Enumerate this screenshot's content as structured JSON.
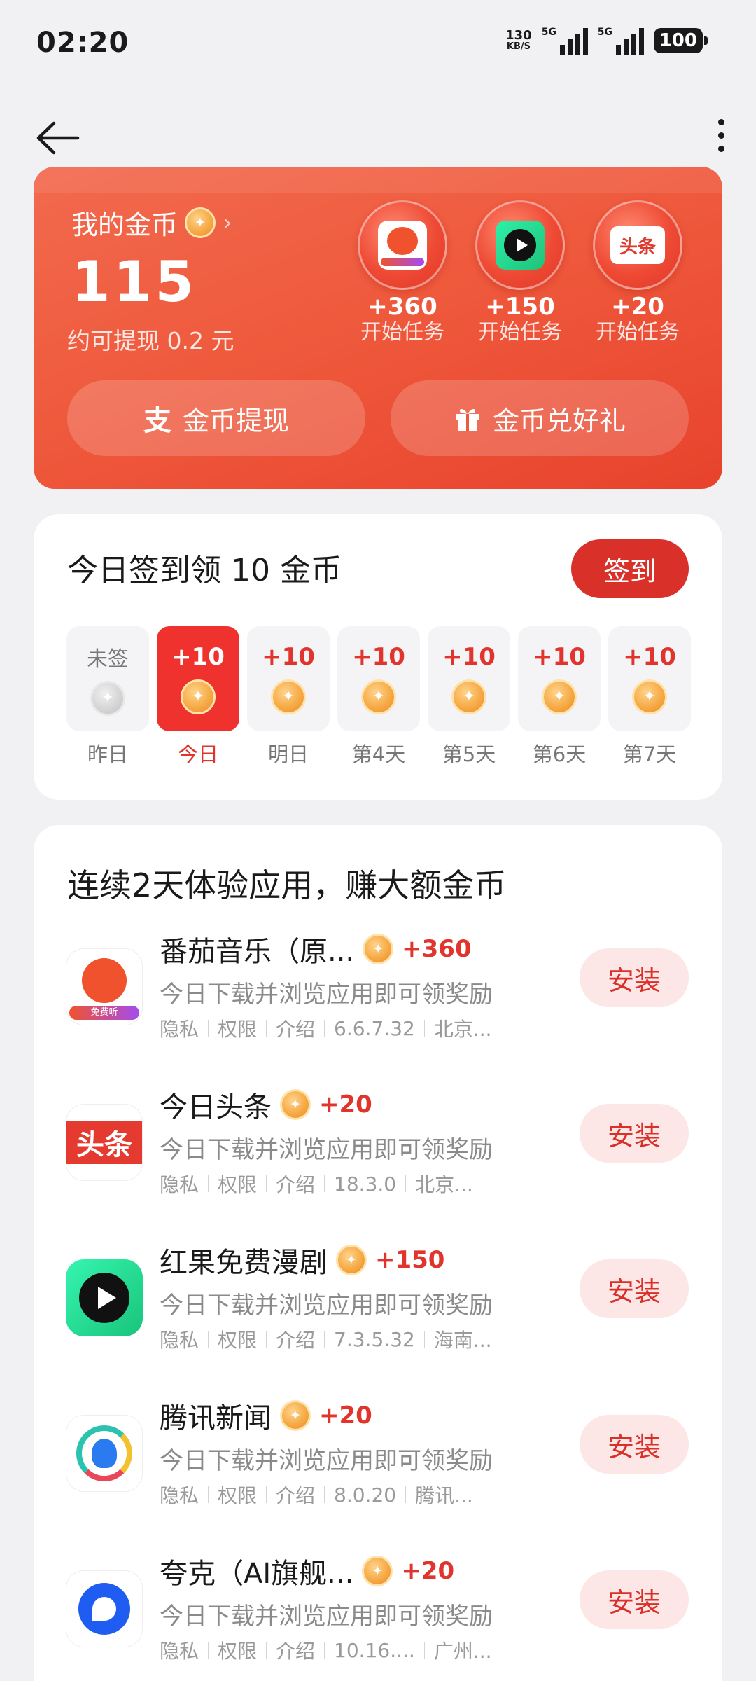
{
  "status_bar": {
    "time": "02:20",
    "speed_value": "130",
    "speed_unit": "KB/S",
    "sim1": "5G",
    "sim2": "5G",
    "battery": "100"
  },
  "coin_card": {
    "title": "我的金币",
    "value": "115",
    "withdraw_estimate": "约可提现 0.2 元",
    "tasks": [
      {
        "reward": "+360",
        "label": "开始任务",
        "icon": "tomato-music-icon"
      },
      {
        "reward": "+150",
        "label": "开始任务",
        "icon": "hongguo-drama-icon"
      },
      {
        "reward": "+20",
        "label": "开始任务",
        "icon": "toutiao-icon"
      }
    ],
    "withdraw_button": "金币提现",
    "gift_button": "金币兑好礼",
    "toutiao_icon_text": "头条"
  },
  "sign_in": {
    "title": "今日签到领 10 金币",
    "button": "签到",
    "days": [
      {
        "amount": "未签",
        "label": "昨日",
        "state": "missed"
      },
      {
        "amount": "+10",
        "label": "今日",
        "state": "today"
      },
      {
        "amount": "+10",
        "label": "明日",
        "state": "future"
      },
      {
        "amount": "+10",
        "label": "第4天",
        "state": "future"
      },
      {
        "amount": "+10",
        "label": "第5天",
        "state": "future"
      },
      {
        "amount": "+10",
        "label": "第6天",
        "state": "future"
      },
      {
        "amount": "+10",
        "label": "第7天",
        "state": "future"
      }
    ]
  },
  "apps_section": {
    "title": "连续2天体验应用，赚大额金币",
    "install_label": "安装",
    "apps": [
      {
        "name": "番茄音乐（原...",
        "reward": "+360",
        "desc": "今日下载并浏览应用即可领奖励",
        "privacy": "隐私",
        "perm": "权限",
        "intro": "介绍",
        "version": "6.6.7.32",
        "developer": "北京..."
      },
      {
        "name": "今日头条",
        "reward": "+20",
        "desc": "今日下载并浏览应用即可领奖励",
        "privacy": "隐私",
        "perm": "权限",
        "intro": "介绍",
        "version": "18.3.0",
        "developer": "北京..."
      },
      {
        "name": "红果免费漫剧",
        "reward": "+150",
        "desc": "今日下载并浏览应用即可领奖励",
        "privacy": "隐私",
        "perm": "权限",
        "intro": "介绍",
        "version": "7.3.5.32",
        "developer": "海南..."
      },
      {
        "name": "腾讯新闻",
        "reward": "+20",
        "desc": "今日下载并浏览应用即可领奖励",
        "privacy": "隐私",
        "perm": "权限",
        "intro": "介绍",
        "version": "8.0.20",
        "developer": "腾讯..."
      },
      {
        "name": "夸克（AI旗舰...",
        "reward": "+20",
        "desc": "今日下载并浏览应用即可领奖励",
        "privacy": "隐私",
        "perm": "权限",
        "intro": "介绍",
        "version": "10.16....",
        "developer": "广州..."
      }
    ],
    "tomato_badge": "免费听",
    "toutiao_icon_text": "头条"
  },
  "colors": {
    "accent_red": "#d9302a",
    "card_orange": "#ef5a3d",
    "coin_gold": "#f5a742"
  }
}
